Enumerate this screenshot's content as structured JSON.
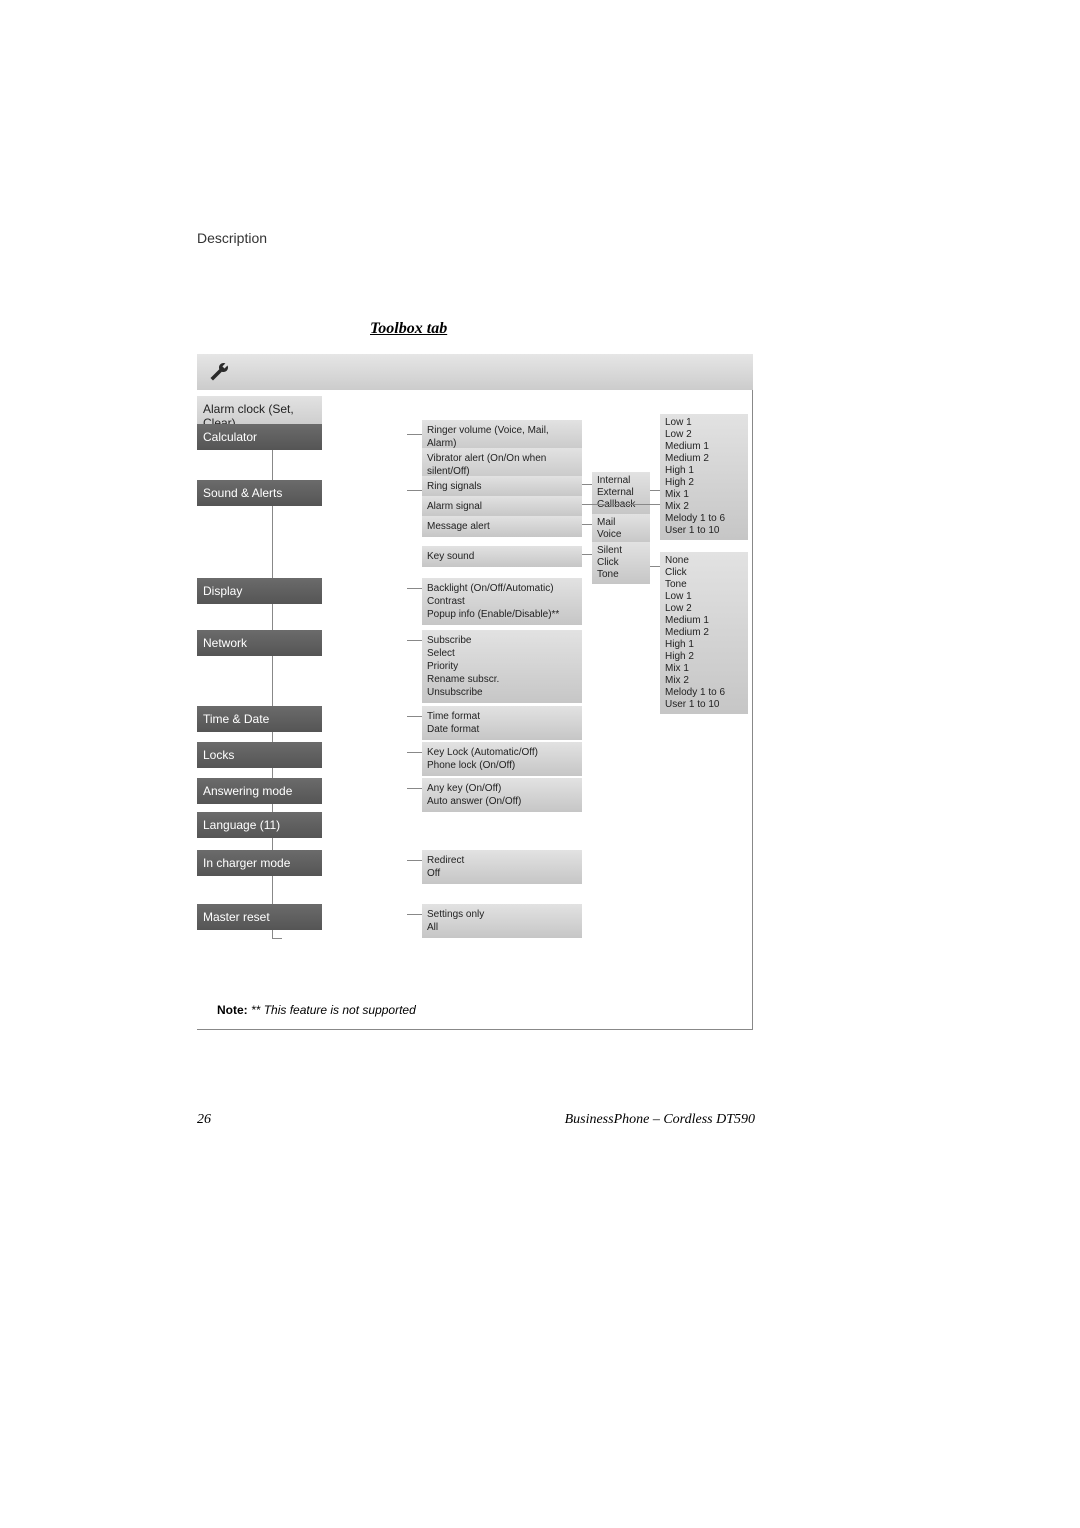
{
  "header": {
    "section_label": "Description"
  },
  "title": "Toolbox tab",
  "toolbox_label": "Toolbox",
  "menu": {
    "alarm_clock": "Alarm clock (Set, Clear)",
    "calculator": "Calculator",
    "sound_alerts": "Sound & Alerts",
    "display": "Display",
    "network": "Network",
    "time_date": "Time & Date",
    "locks": "Locks",
    "answering_mode": "Answering mode",
    "language": "Language (11)",
    "in_charger_mode": "In charger mode",
    "master_reset": "Master reset"
  },
  "col3": {
    "ringer_volume": "Ringer volume (Voice, Mail, Alarm)",
    "vibrator_alert": "Vibrator alert (On/On when silent/Off)",
    "ring_signals": "Ring signals",
    "alarm_signal": "Alarm signal",
    "message_alert": "Message alert",
    "key_sound": "Key sound",
    "display_opts": "Backlight (On/Off/Automatic)\nContrast\nPopup info (Enable/Disable)**",
    "network_opts": "Subscribe\nSelect\nPriority\nRename subscr.\nUnsubscribe",
    "time_date_opts": "Time format\nDate format",
    "locks_opts": "Key Lock (Automatic/Off)\nPhone lock (On/Off)",
    "answering_opts": "Any key (On/Off)\nAuto answer (On/Off)",
    "charger_opts": "Redirect\nOff",
    "reset_opts": "Settings only\nAll"
  },
  "col4": {
    "ring_types": "Internal\nExternal\nCallback",
    "msg_types": "Mail\nVoice",
    "key_types": "Silent\nClick\nTone"
  },
  "col5": {
    "ringer_list": "Low 1\nLow 2\nMedium 1\nMedium 2\nHigh 1\nHigh 2\nMix 1\nMix 2\nMelody 1 to 6\nUser 1 to 10",
    "key_list": "None\nClick\nTone\nLow 1\nLow 2\nMedium 1\nMedium 2\nHigh 1\nHigh 2\nMix 1\nMix 2\nMelody 1 to 6\nUser 1 to 10"
  },
  "note": {
    "prefix": "Note: ",
    "stars": "** ",
    "text": "This feature is not supported"
  },
  "footer": {
    "page": "26",
    "doc": "BusinessPhone – Cordless DT590"
  }
}
